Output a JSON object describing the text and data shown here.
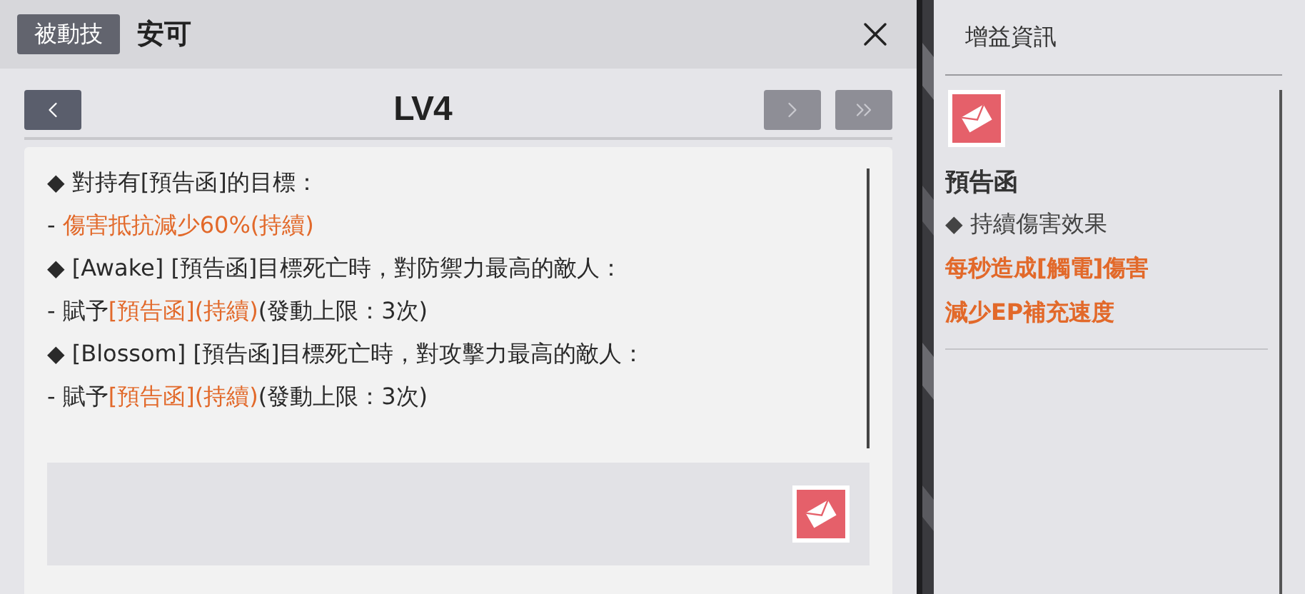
{
  "header": {
    "badge": "被動技",
    "title": "安可"
  },
  "level_nav": {
    "level": "LV4",
    "buttons": [
      {
        "kind": "prev",
        "disabled": false
      },
      {
        "kind": "next",
        "disabled": true
      },
      {
        "kind": "last",
        "disabled": true
      }
    ]
  },
  "description": [
    {
      "segments": [
        {
          "text": "◆ 對持有[預告函]的目標：",
          "kind": "normal"
        }
      ]
    },
    {
      "segments": [
        {
          "text": "- ",
          "kind": "normal"
        },
        {
          "text": "傷害抵抗減少60%(持續)",
          "kind": "accent"
        }
      ]
    },
    {
      "segments": [
        {
          "text": "◆ [Awake] [預告函]目標死亡時，對防禦力最高的敵人：",
          "kind": "normal"
        }
      ]
    },
    {
      "segments": [
        {
          "text": "- 賦予",
          "kind": "normal"
        },
        {
          "text": "[預告函](持續)",
          "kind": "accent"
        },
        {
          "text": "(發動上限：3次)",
          "kind": "normal"
        }
      ]
    },
    {
      "segments": [
        {
          "text": "◆ [Blossom] [預告函]目標死亡時，對攻擊力最高的敵人：",
          "kind": "normal"
        }
      ]
    },
    {
      "segments": [
        {
          "text": "- 賦予",
          "kind": "normal"
        },
        {
          "text": "[預告函](持續)",
          "kind": "accent"
        },
        {
          "text": "(發動上限：3次)",
          "kind": "normal"
        }
      ]
    }
  ],
  "buff_panel": {
    "title": "增益資訊",
    "buffs": [
      {
        "name": "預告函",
        "lines": [
          {
            "text": "◆ 持續傷害效果",
            "kind": "normal"
          },
          {
            "text": "每秒造成[觸電]傷害",
            "kind": "accent"
          },
          {
            "text": "減少EP補充速度",
            "kind": "accent"
          }
        ]
      }
    ]
  }
}
